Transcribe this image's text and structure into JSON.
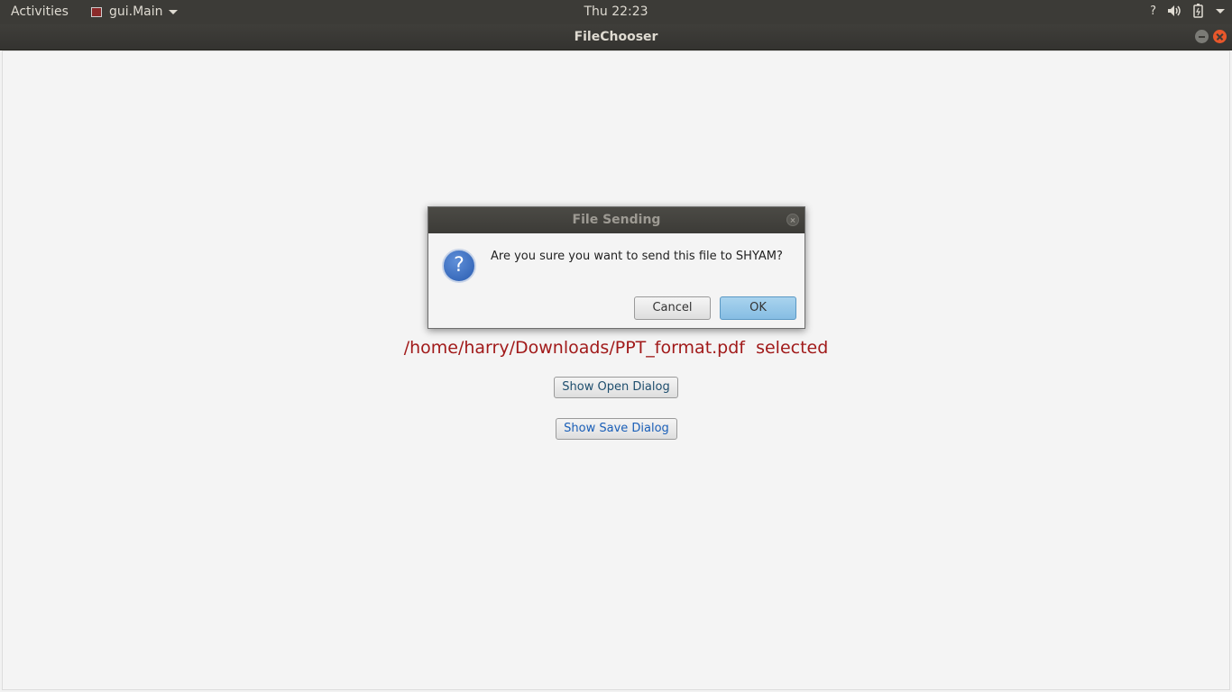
{
  "topbar": {
    "activities": "Activities",
    "app_menu": "gui.Main",
    "clock": "Thu 22:23",
    "help": "?"
  },
  "window": {
    "title": "FileChooser"
  },
  "main": {
    "selected_text": "/home/harry/Downloads/PPT_format.pdf  selected",
    "open_dialog_label": "Show Open Dialog",
    "save_dialog_label": "Show Save Dialog"
  },
  "dialog": {
    "title": "File Sending",
    "icon": "?",
    "message": "Are you sure you want to send this file to SHYAM?",
    "cancel_label": "Cancel",
    "ok_label": "OK"
  },
  "colors": {
    "panel": "#3c3b37",
    "selected_text": "#a11a1a",
    "ok_button": "#a9d3ee",
    "close_button": "#e8572b"
  }
}
